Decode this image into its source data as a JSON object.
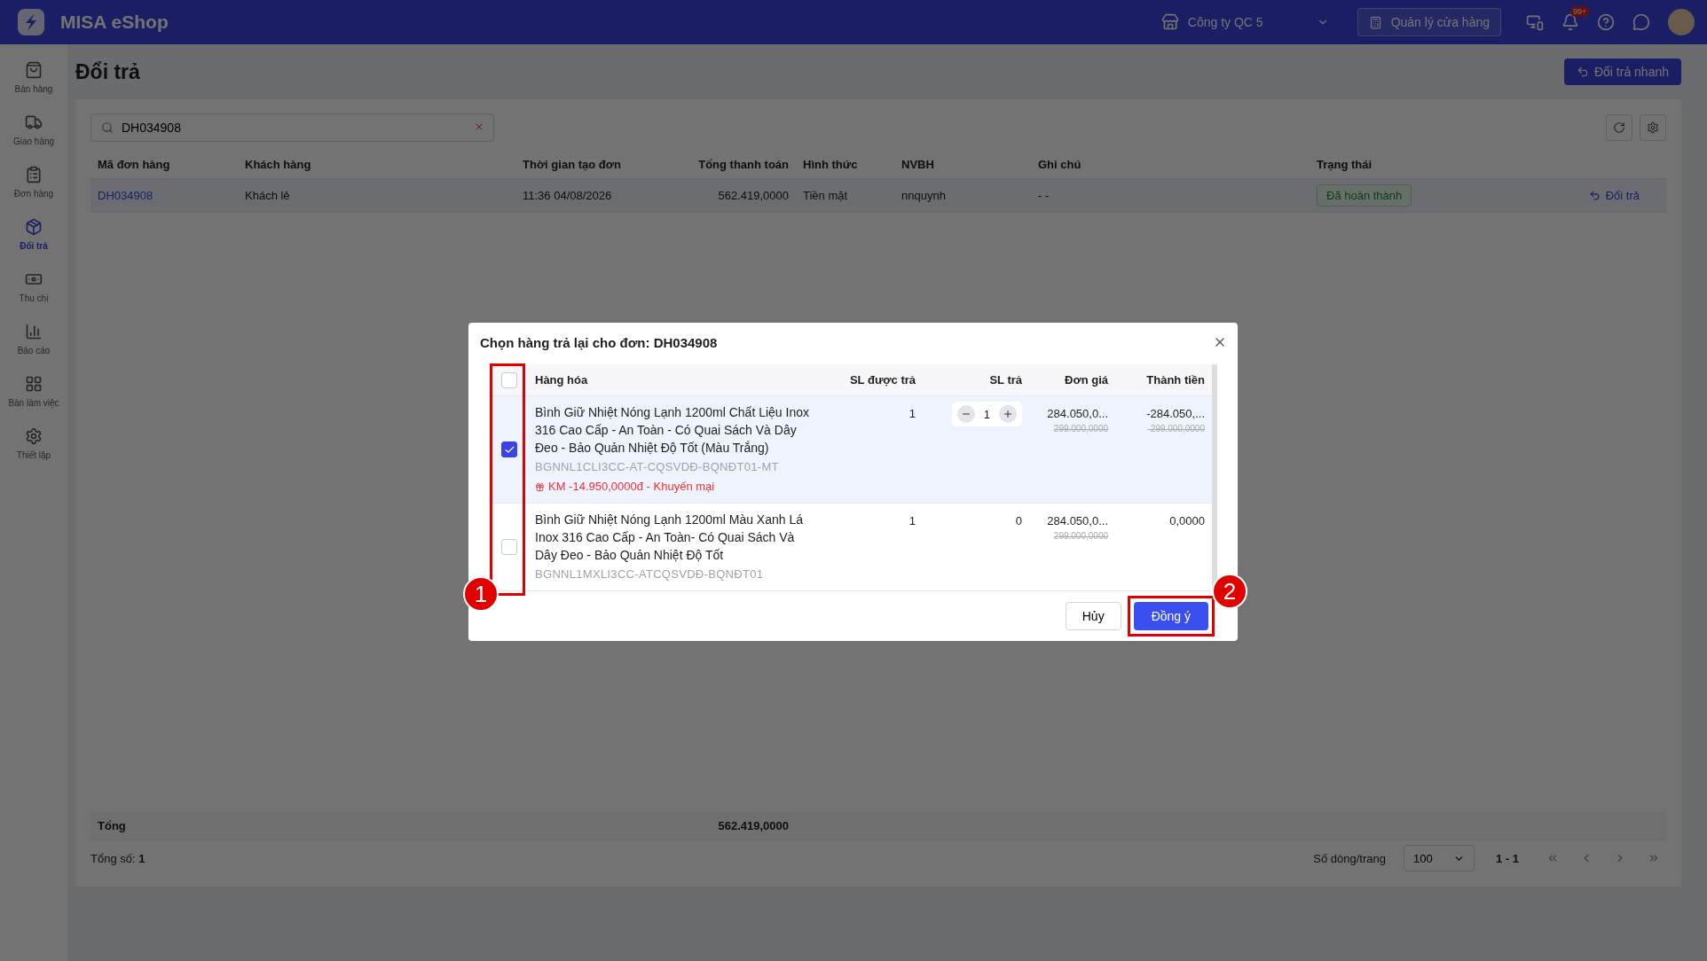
{
  "app": {
    "name": "MISA eShop"
  },
  "topbar": {
    "company": "Công ty QC 5",
    "store_button": "Quản lý cửa hàng",
    "notification_badge": "99+"
  },
  "sidebar": [
    {
      "label": "Bán hàng",
      "selected": false
    },
    {
      "label": "Giao hàng",
      "selected": false
    },
    {
      "label": "Đơn hàng",
      "selected": false
    },
    {
      "label": "Đổi trả",
      "selected": true
    },
    {
      "label": "Thu chi",
      "selected": false
    },
    {
      "label": "Báo cáo",
      "selected": false
    },
    {
      "label": "Bàn làm việc",
      "selected": false
    },
    {
      "label": "Thiết lập",
      "selected": false
    }
  ],
  "page": {
    "title": "Đổi trả",
    "quick_button": "Đổi trả nhanh"
  },
  "search": {
    "value": "DH034908"
  },
  "table": {
    "columns": [
      "Mã đơn hàng",
      "Khách hàng",
      "Thời gian tạo đơn",
      "Tổng thanh toán",
      "Hình thức",
      "NVBH",
      "Ghi chú",
      "Trạng thái"
    ],
    "rows": [
      {
        "cells": [
          "DH034908",
          "Khách lẻ",
          "11:36 04/08/2026",
          "562.419,0000",
          "Tiền mặt",
          "nnquynh",
          "- -"
        ],
        "status": "Đã hoàn thành",
        "action": "Đổi trả"
      }
    ],
    "total": {
      "label": "Tổng",
      "value": "562.419,0000"
    }
  },
  "footer": {
    "count_label": "Tổng số:",
    "count": "1",
    "page_size_label": "Số dòng/trang",
    "page_size": "100",
    "range": "1 - 1"
  },
  "dialog": {
    "title": "Chọn hàng trả lại cho đơn: DH034908",
    "select_all": false,
    "columns": [
      "Hàng hóa",
      "SL được trả",
      "SL trả",
      "Đơn giá",
      "Thành tiền"
    ],
    "items": [
      {
        "checked": true,
        "kind": "stepper",
        "name": "Bình Giữ Nhiệt Nóng Lạnh 1200ml Chất Liệu Inox 316 Cao Cấp - An Toàn - Có Quai Sách Và Dây Đeo - Bảo Quản Nhiệt Độ Tốt (Màu Trắng)",
        "sku": "BGNNL1CLI3CC-AT-CQSVDĐ-BQNĐT01-MT",
        "promo": "KM -14.950,0000đ - Khuyến mại",
        "returnable": "1",
        "qty": "1",
        "price": "284.050,0...",
        "old_price": "299.000,0000",
        "amount": "-284.050,...",
        "old_amount": "-299.000,0000"
      },
      {
        "checked": false,
        "kind": "plain",
        "name": "Bình Giữ Nhiệt Nóng Lạnh 1200ml Màu Xanh Lá Inox 316 Cao Cấp - An Toàn- Có Quai Sách Và Dây Đeo - Bảo Quản Nhiệt Độ Tốt",
        "sku": "BGNNL1MXLI3CC-ATCQSVDĐ-BQNĐT01",
        "returnable": "1",
        "qty": "0",
        "price": "284.050,0...",
        "old_price": "299.000,0000",
        "amount": "0,0000"
      }
    ],
    "cancel": "Hủy",
    "confirm": "Đồng ý"
  },
  "annotations": [
    {
      "label": "1"
    },
    {
      "label": "2"
    }
  ]
}
